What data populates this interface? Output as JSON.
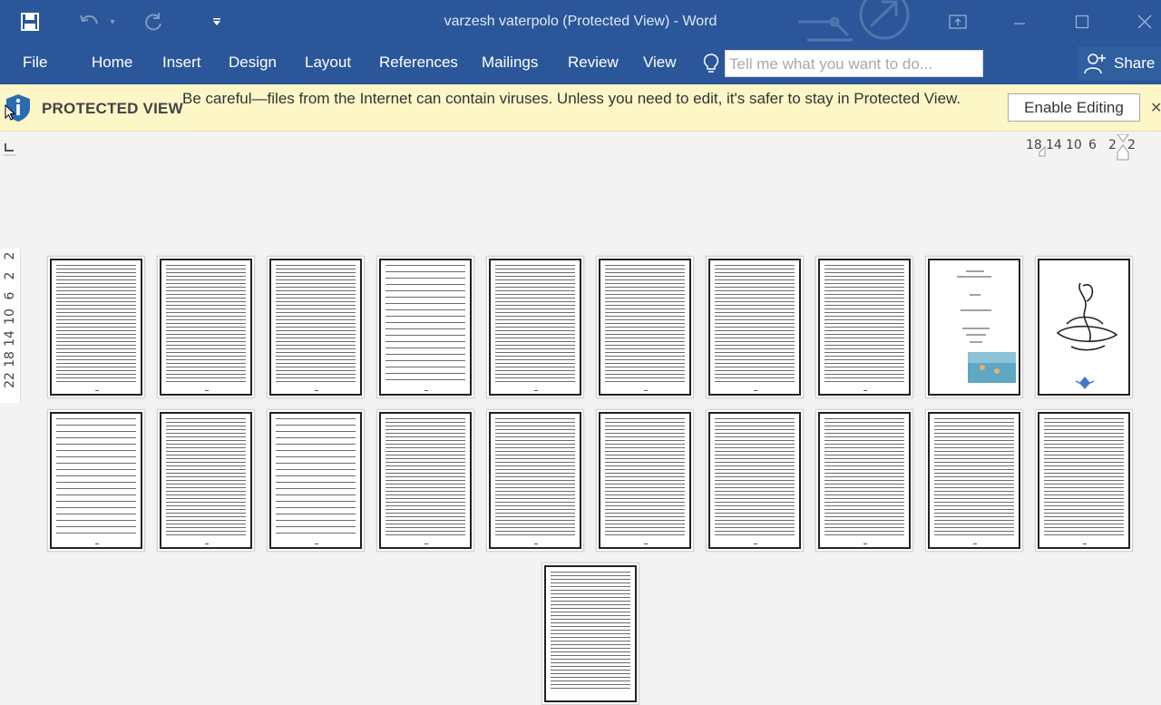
{
  "window": {
    "title": "varzesh vaterpolo (Protected View) - Word",
    "accent_color": "#2b579a",
    "controls": [
      "ribbon-display-icon",
      "minimize-icon",
      "maximize-icon",
      "close-icon"
    ]
  },
  "quick_access": {
    "icons": [
      "save-icon",
      "undo-icon",
      "redo-icon",
      "customize-qat-icon"
    ]
  },
  "ribbon": {
    "tabs": [
      "File",
      "Home",
      "Insert",
      "Design",
      "Layout",
      "References",
      "Mailings",
      "Review",
      "View"
    ],
    "tell_me_placeholder": "Tell me what you want to do...",
    "share_label": "Share"
  },
  "protected_view": {
    "title": "PROTECTED VIEW",
    "message": "Be careful—files from the Internet can contain viruses. Unless you need to edit, it's safer to stay in Protected View.",
    "enable_button": "Enable Editing",
    "bar_color": "#fdf6c7"
  },
  "rulers": {
    "horizontal": [
      "18",
      "14",
      "10",
      "6",
      "2",
      "2"
    ],
    "vertical": [
      "2",
      "2",
      "6",
      "10",
      "14",
      "18",
      "22"
    ]
  },
  "document": {
    "view": "multi-page thumbnails",
    "page_rows": [
      10,
      10,
      1
    ],
    "total_pages": 21
  }
}
